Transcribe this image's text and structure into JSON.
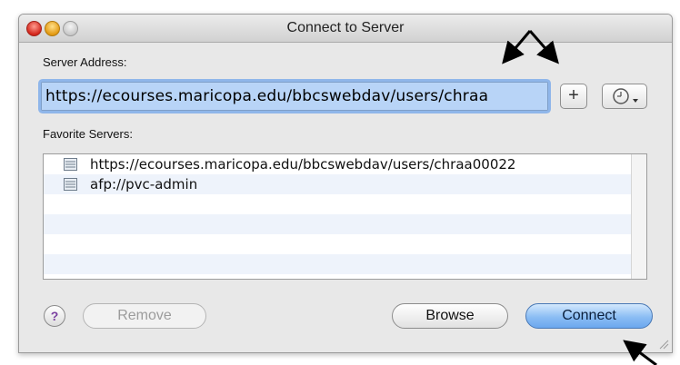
{
  "window": {
    "title": "Connect to Server"
  },
  "server_address": {
    "label": "Server Address:",
    "value": "https://ecourses.maricopa.edu/bbcswebdav/users/chraa"
  },
  "favorites": {
    "label": "Favorite Servers:",
    "items": [
      "https://ecourses.maricopa.edu/bbcswebdav/users/chraa00022",
      "afp://pvc-admin"
    ]
  },
  "buttons": {
    "add": "+",
    "help": "?",
    "remove": "Remove",
    "browse": "Browse",
    "connect": "Connect"
  },
  "icons": [
    "close-icon",
    "minimize-icon",
    "zoom-icon",
    "recent-servers-clock-icon",
    "server-icon",
    "resize-grip-icon"
  ],
  "colors": {
    "selection": "#b8d4f7",
    "focus_ring": "#8fb6ea",
    "connect_button": "#8bbdf4"
  }
}
